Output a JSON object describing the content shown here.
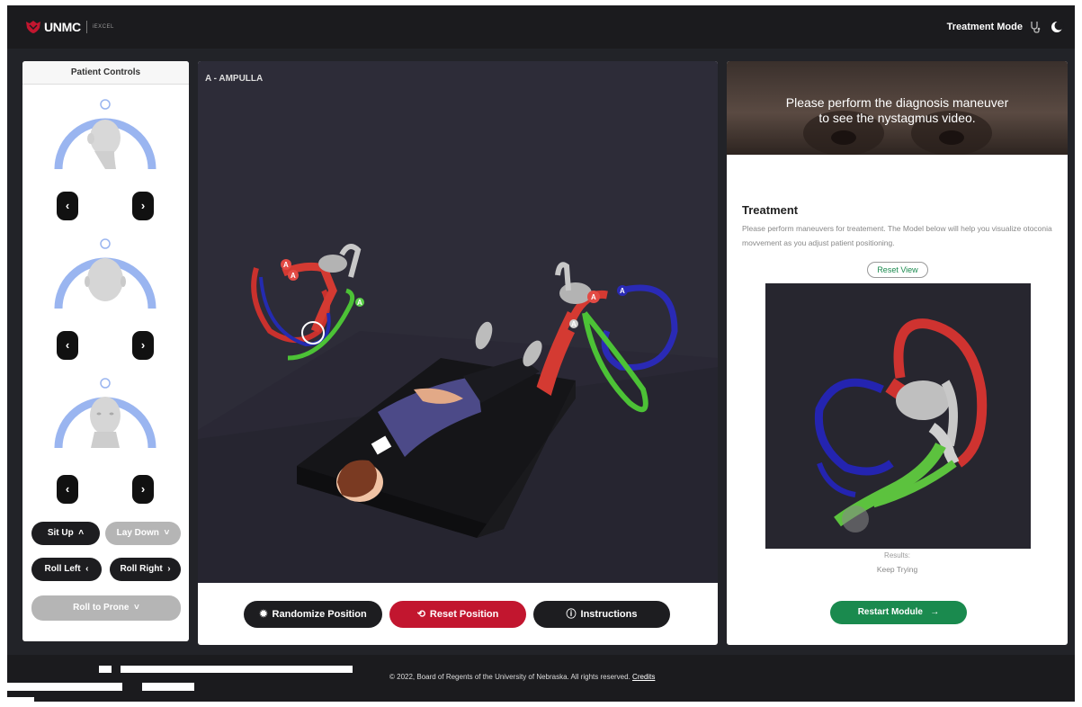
{
  "header": {
    "logo_text": "UNMC",
    "logo_sub": "iEXCEL",
    "mode_label": "Treatment Mode",
    "icons": [
      "stethoscope-icon",
      "moon-icon"
    ]
  },
  "patient_controls": {
    "title": "Patient Controls",
    "prev_glyph": "‹",
    "next_glyph": "›",
    "sit_up": "Sit Up",
    "lay_down": "Lay Down",
    "roll_left": "Roll Left",
    "roll_right": "Roll Right",
    "roll_to_prone": "Roll to Prone"
  },
  "scene": {
    "label": "A - AMPULLA",
    "marker": "A"
  },
  "actions": {
    "randomize": "Randomize Position",
    "reset": "Reset Position",
    "instructions": "Instructions"
  },
  "video": {
    "message_line1": "Please perform the diagnosis maneuver",
    "message_line2": "to see the nystagmus video."
  },
  "treatment": {
    "title": "Treatment",
    "description": "Please perform maneuvers for treatement. The Model below will help you visualize otoconia movvement as you adjust patient positioning.",
    "reset_view": "Reset View",
    "results_label": "Results:",
    "results_value": "Keep Trying",
    "restart": "Restart Module"
  },
  "footer": {
    "copyright": "© 2022, Board of Regents of the University of Nebraska. All rights reserved.",
    "credits": "Credits"
  },
  "colors": {
    "brand_red": "#c2162f",
    "green": "#1a8a4e",
    "dark": "#1d1d20",
    "ring_blue": "#9ab5f0"
  }
}
